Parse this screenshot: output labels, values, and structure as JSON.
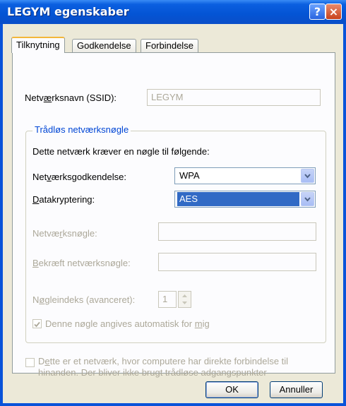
{
  "window": {
    "title": "LEGYM egenskaber",
    "help_label": "?",
    "close_label": "×"
  },
  "tabs": [
    {
      "label": "Tilknytning",
      "active": true
    },
    {
      "label": "Godkendelse",
      "active": false
    },
    {
      "label": "Forbindelse",
      "active": false
    }
  ],
  "ssid": {
    "label_pre": "Netv",
    "label_u": "æ",
    "label_post": "rksnavn (SSID):",
    "value": "LEGYM"
  },
  "wireless_key_group": {
    "title": "Trådløs netværksnøgle",
    "intro": "Dette netværk kræver en nøgle til følgende:",
    "auth": {
      "label_pre": "Net",
      "label_u": "v",
      "label_post": "ærksgodkendelse:",
      "value": "WPA"
    },
    "encryption": {
      "label_pre": "",
      "label_u": "D",
      "label_post": "atakryptering:",
      "value": "AES"
    },
    "network_key": {
      "label_pre": "Netvæ",
      "label_u": "r",
      "label_post": "ksnøgle:",
      "value": ""
    },
    "confirm_key": {
      "label_pre": "",
      "label_u": "B",
      "label_post": "ekræft netværksnøgle:",
      "value": ""
    },
    "key_index": {
      "label_pre": "N",
      "label_u": "ø",
      "label_post": "gleindeks (avanceret):",
      "value": "1"
    },
    "auto_key": {
      "label_pre": "Denne nøgle angives automatisk for ",
      "label_u": "m",
      "label_post": "ig",
      "checked": true
    }
  },
  "adhoc": {
    "line1_pre": "D",
    "line1_u": "e",
    "line1_post": "tte er et netværk, hvor computere har direkte forbindelse til",
    "line2": "hinanden. Der bliver ikke brugt trådløse adgangspunkter",
    "checked": false
  },
  "buttons": {
    "ok": "OK",
    "cancel": "Annuller"
  },
  "colors": {
    "titlebar": "#0454d4",
    "selection": "#316ac5",
    "group_title": "#0046d5"
  }
}
